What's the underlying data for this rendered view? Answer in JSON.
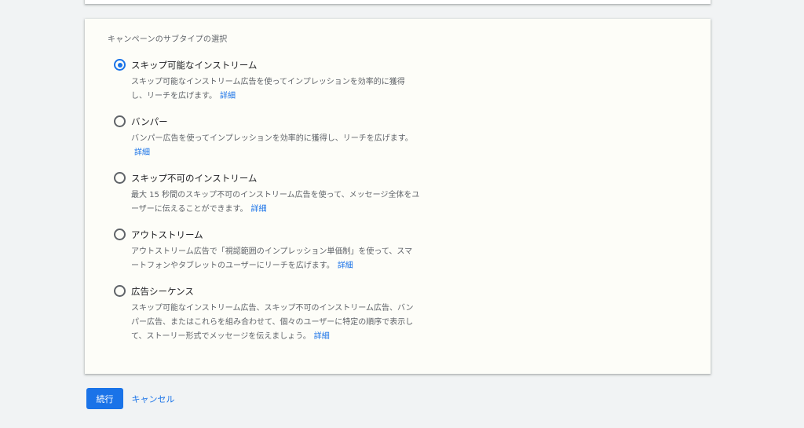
{
  "section": {
    "title": "キャンペーンのサブタイプの選択"
  },
  "options": [
    {
      "label": "スキップ可能なインストリーム",
      "description": "スキップ可能なインストリーム広告を使ってインプレッションを効率的に獲得し、リーチを広げます。",
      "link": "詳細",
      "selected": true
    },
    {
      "label": "バンパー",
      "description": "バンパー広告を使ってインプレッションを効率的に獲得し、リーチを広げます。",
      "link": "詳細",
      "selected": false
    },
    {
      "label": "スキップ不可のインストリーム",
      "description": "最大 15 秒間のスキップ不可のインストリーム広告を使って、メッセージ全体をユーザーに伝えることができます。",
      "link": "詳細",
      "selected": false
    },
    {
      "label": "アウトストリーム",
      "description": "アウトストリーム広告で「視認範囲のインプレッション単価制」を使って、スマートフォンやタブレットのユーザーにリーチを広げます。",
      "link": "詳細",
      "selected": false
    },
    {
      "label": "広告シーケンス",
      "description": "スキップ可能なインストリーム広告、スキップ不可のインストリーム広告、バンパー広告、またはこれらを組み合わせて、個々のユーザーに特定の順序で表示して、ストーリー形式でメッセージを伝えましょう。",
      "link": "詳細",
      "selected": false
    }
  ],
  "actions": {
    "continue_label": "続行",
    "cancel_label": "キャンセル"
  },
  "colors": {
    "accent": "#1a73e8",
    "background": "#f1f3f4",
    "card": "#fdfdf8"
  }
}
